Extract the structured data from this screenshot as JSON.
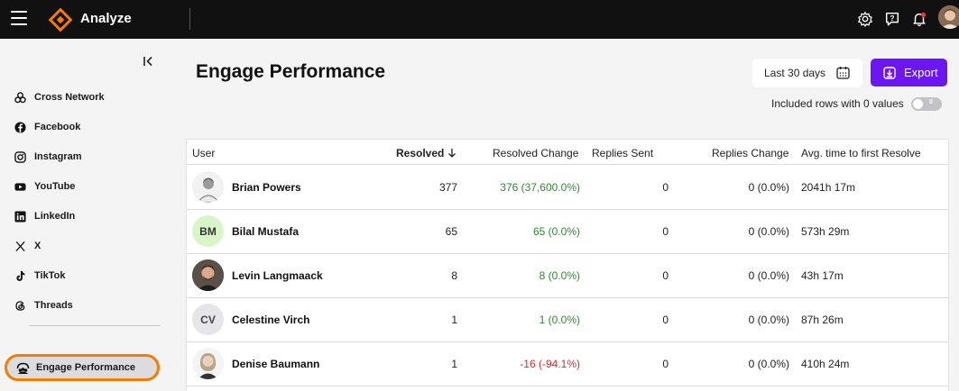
{
  "app": {
    "title": "Analyze"
  },
  "sidebar": {
    "items": [
      {
        "label": "Cross Network"
      },
      {
        "label": "Facebook"
      },
      {
        "label": "Instagram"
      },
      {
        "label": "YouTube"
      },
      {
        "label": "LinkedIn"
      },
      {
        "label": "X"
      },
      {
        "label": "TikTok"
      },
      {
        "label": "Threads"
      }
    ],
    "active": {
      "label": "Engage Performance"
    }
  },
  "main": {
    "title": "Engage Performance",
    "date_range": "Last 30 days",
    "export_label": "Export",
    "included_label": "Included rows with 0 values",
    "toggle_value": "0"
  },
  "table": {
    "headers": {
      "user": "User",
      "resolved": "Resolved",
      "resolved_change": "Resolved Change",
      "replies_sent": "Replies Sent",
      "replies_change": "Replies Change",
      "avg_time": "Avg. time to first Resolve"
    },
    "rows": [
      {
        "initials": "",
        "name": "Brian Powers",
        "resolved": "377",
        "resolved_change": "376 (37,600.0%)",
        "replies_sent": "0",
        "replies_change": "0 (0.0%)",
        "avg_time": "2041h 17m"
      },
      {
        "initials": "BM",
        "name": "Bilal Mustafa",
        "resolved": "65",
        "resolved_change": "65 (0.0%)",
        "replies_sent": "0",
        "replies_change": "0 (0.0%)",
        "avg_time": "573h 29m"
      },
      {
        "initials": "",
        "name": "Levin Langmaack",
        "resolved": "8",
        "resolved_change": "8 (0.0%)",
        "replies_sent": "0",
        "replies_change": "0 (0.0%)",
        "avg_time": "43h 17m"
      },
      {
        "initials": "CV",
        "name": "Celestine Virch",
        "resolved": "1",
        "resolved_change": "1 (0.0%)",
        "replies_sent": "0",
        "replies_change": "0 (0.0%)",
        "avg_time": "87h 26m"
      },
      {
        "initials": "",
        "name": "Denise Baumann",
        "resolved": "1",
        "resolved_change": "-16 (-94.1%)",
        "replies_sent": "0",
        "replies_change": "0 (0.0%)",
        "avg_time": "410h 24m"
      }
    ]
  },
  "colors": {
    "accent": "#6d16f5",
    "brand_orange": "#f57c00",
    "positive": "#2e8b2e",
    "negative": "#d32f2f"
  },
  "icons": [
    "menu-icon",
    "logo-icon",
    "gear-icon",
    "help-icon",
    "bell-icon",
    "collapse-icon",
    "calendar-icon",
    "download-icon"
  ]
}
